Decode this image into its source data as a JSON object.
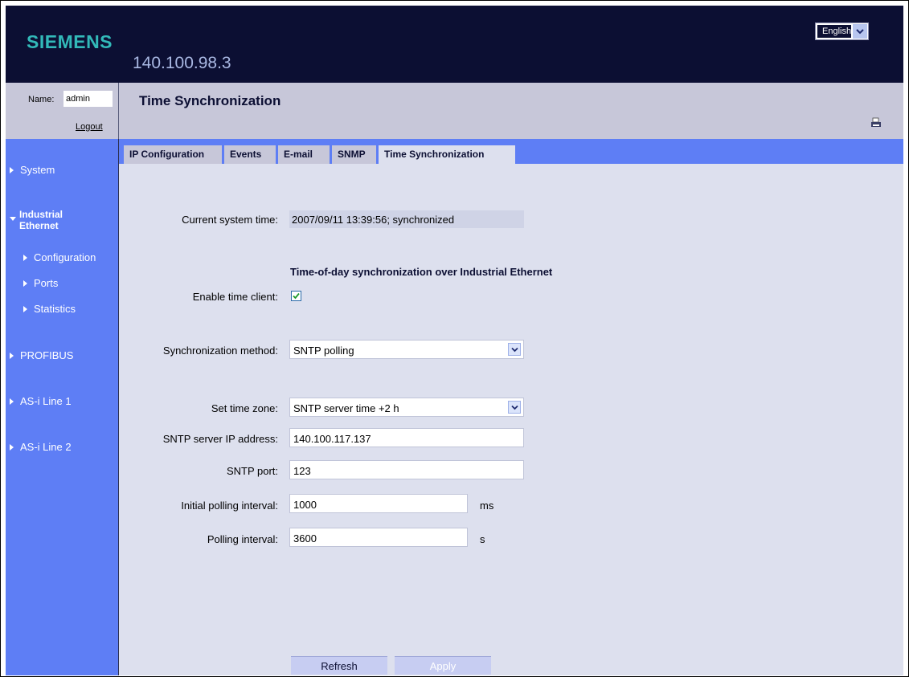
{
  "header": {
    "logo": "SIEMENS",
    "ip_address": "140.100.98.3",
    "language": "English"
  },
  "login": {
    "name_label": "Name:",
    "name_value": "admin",
    "logout_label": "Logout"
  },
  "sidebar": {
    "system": "System",
    "industrial_ethernet_line1": "Industrial",
    "industrial_ethernet_line2": "Ethernet",
    "configuration": "Configuration",
    "ports": "Ports",
    "statistics": "Statistics",
    "profibus": "PROFIBUS",
    "asi_line1": "AS-i Line 1",
    "asi_line2": "AS-i Line 2"
  },
  "page": {
    "title": "Time Synchronization"
  },
  "tabs": [
    "IP Configuration",
    "Events",
    "E-mail",
    "SNMP",
    "Time Synchronization"
  ],
  "form": {
    "current_time_label": "Current system time:",
    "current_time_value": "2007/09/11 13:39:56; synchronized",
    "section_heading": "Time-of-day synchronization over Industrial Ethernet",
    "enable_client_label": "Enable time client:",
    "enable_client_checked": true,
    "sync_method_label": "Synchronization method:",
    "sync_method_value": "SNTP polling",
    "time_zone_label": "Set time zone:",
    "time_zone_value": "SNTP server time +2 h",
    "server_ip_label": "SNTP server IP address:",
    "server_ip_value": "140.100.117.137",
    "port_label": "SNTP port:",
    "port_value": "123",
    "initial_interval_label": "Initial polling interval:",
    "initial_interval_value": "1000",
    "initial_interval_unit": "ms",
    "polling_interval_label": "Polling interval:",
    "polling_interval_value": "3600",
    "polling_interval_unit": "s"
  },
  "buttons": {
    "refresh": "Refresh",
    "apply": "Apply"
  },
  "colors": {
    "header_bg": "#0c0f33",
    "sidebar_bg": "#5e7ef5",
    "content_bg": "#dde0ee",
    "title_bar_bg": "#c7c7d9",
    "logo": "#32b9b9"
  }
}
